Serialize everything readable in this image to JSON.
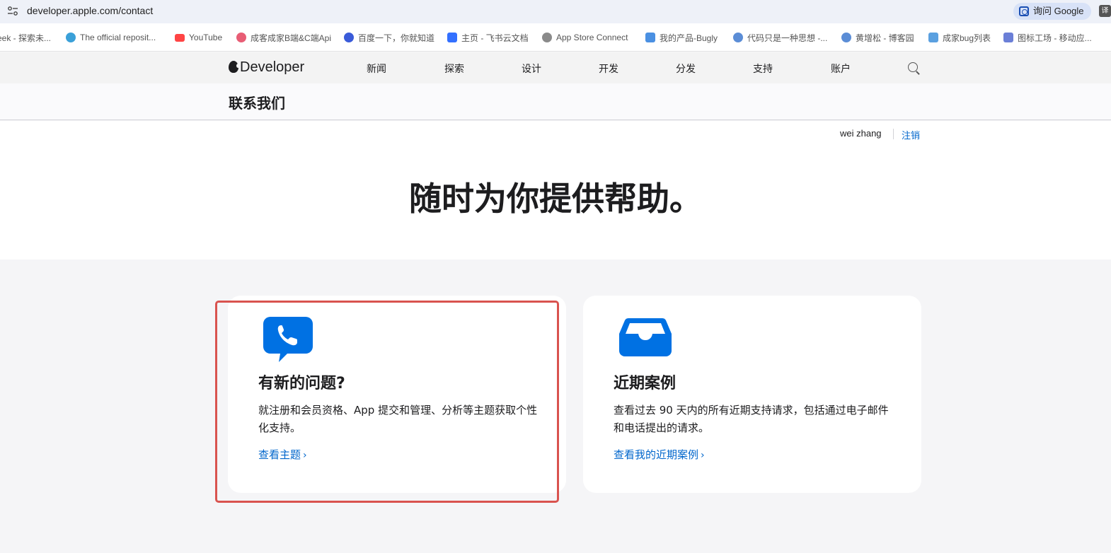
{
  "browser": {
    "url": "developer.apple.com/contact",
    "ask_google": "询问 Google",
    "translate_label": "译"
  },
  "bookmarks": [
    {
      "label": "eek - 探索未...",
      "color": "#6c8ebf"
    },
    {
      "label": "The official reposit...",
      "color": "#3aa0d8"
    },
    {
      "label": "YouTube",
      "color": "#ff4444"
    },
    {
      "label": "成客成家B端&C端Api",
      "color": "#e85d75"
    },
    {
      "label": "百度一下，你就知道",
      "color": "#3a5bd9"
    },
    {
      "label": "主页 - 飞书云文档",
      "color": "#3370ff"
    },
    {
      "label": "App Store Connect",
      "color": "#8a8a8a"
    },
    {
      "label": "我的产品-Bugly",
      "color": "#4a90e2"
    },
    {
      "label": "代码只是一种思想 -...",
      "color": "#5b8dd6"
    },
    {
      "label": "黄增松 - 博客园",
      "color": "#5b8dd6"
    },
    {
      "label": "成家bug列表",
      "color": "#5aa0e0"
    },
    {
      "label": "图标工场 - 移动应...",
      "color": "#6b7fd7"
    }
  ],
  "nav": {
    "logo_text": "Developer",
    "items": [
      "新闻",
      "探索",
      "设计",
      "开发",
      "分发",
      "支持",
      "账户"
    ]
  },
  "local_nav": {
    "title": "联系我们"
  },
  "hero": {
    "user": "wei zhang",
    "logout": "注销",
    "title": "随时为你提供帮助。"
  },
  "cards": [
    {
      "title": "有新的问题?",
      "desc": "就注册和会员资格、App 提交和管理、分析等主题获取个性化支持。",
      "link": "查看主题",
      "icon": "phone-chat-icon"
    },
    {
      "title": "近期案例",
      "desc": "查看过去 90 天内的所有近期支持请求，包括通过电子邮件和电话提出的请求。",
      "link": "查看我的近期案例",
      "icon": "inbox-tray-icon"
    }
  ],
  "colors": {
    "link": "#0066cc",
    "icon_blue": "#0071e3",
    "highlight": "#d9534f"
  }
}
